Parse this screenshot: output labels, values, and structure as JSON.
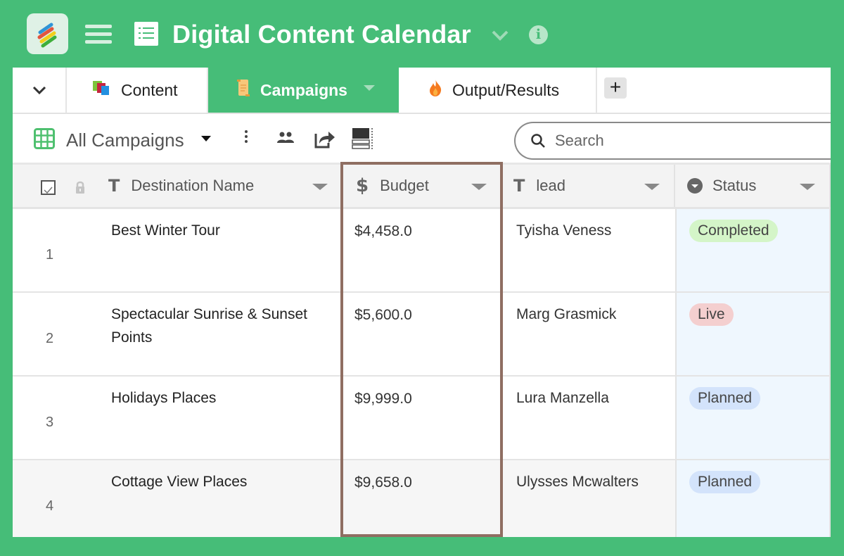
{
  "app": {
    "title": "Digital Content Calendar",
    "icons": {
      "logo": "stacked-stripes-logo",
      "menu": "hamburger-icon",
      "doc": "list-document-icon",
      "title_dropdown": "chevron-down-icon",
      "info": "info-icon"
    },
    "info_glyph": "i"
  },
  "tabs": [
    {
      "label": "Content",
      "icon": "stacked-squares-icon",
      "active": false
    },
    {
      "label": "Campaigns",
      "icon": "scroll-icon",
      "active": true
    },
    {
      "label": "Output/Results",
      "icon": "fire-icon",
      "active": false
    }
  ],
  "add_tab_label": "+",
  "toolbar": {
    "view_name": "All Campaigns",
    "search_placeholder": "Search"
  },
  "table": {
    "columns": [
      {
        "label": "Destination Name",
        "type": "text"
      },
      {
        "label": "Budget",
        "type": "currency"
      },
      {
        "label": "lead",
        "type": "text"
      },
      {
        "label": "Status",
        "type": "single-select"
      }
    ],
    "rows": [
      {
        "num": "1",
        "name": "Best Winter Tour",
        "budget": "$4,458.0",
        "lead": "Tyisha Veness",
        "status": "Completed"
      },
      {
        "num": "2",
        "name": "Spectacular Sunrise & Sunset Points",
        "budget": "$5,600.0",
        "lead": "Marg Grasmick",
        "status": "Live"
      },
      {
        "num": "3",
        "name": "Holidays Places",
        "budget": "$9,999.0",
        "lead": "Lura Manzella",
        "status": "Planned"
      },
      {
        "num": "4",
        "name": "Cottage View Places",
        "budget": "$9,658.0",
        "lead": "Ulysses Mcwalters",
        "status": "Planned"
      }
    ],
    "status_colors": {
      "Completed": "#d4f5c8",
      "Live": "#f4cfcf",
      "Planned": "#d3e3fb"
    }
  },
  "colors": {
    "brand_green": "#46bd78",
    "highlight_outline": "#8f6e62"
  }
}
